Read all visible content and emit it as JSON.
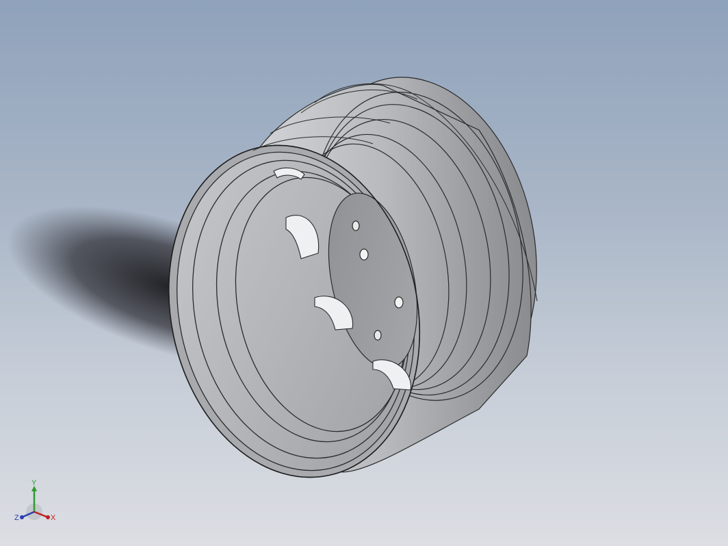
{
  "viewport": {
    "background_top": "#8fa2bb",
    "background_bottom": "#dcdee3",
    "model": {
      "subject": "wheel-rim",
      "surface_color": "#b4b6ba",
      "edge_color": "#2a2a2a",
      "shadow_color": "#1e1e22"
    }
  },
  "triad": {
    "y_label": "Y",
    "z_label": "Z",
    "x_label": "X",
    "y_color": "#2e9a2e",
    "z_color": "#2a3fb0",
    "x_color": "#c02020"
  }
}
